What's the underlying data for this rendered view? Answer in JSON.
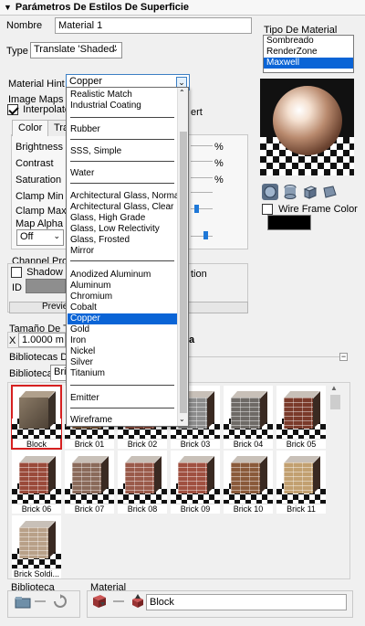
{
  "panel": {
    "title": "Parámetros De Estilos De Superficie"
  },
  "nombre": {
    "label": "Nombre",
    "value": "Material 1"
  },
  "type": {
    "label": "Type",
    "value": "Translate 'Shaded'"
  },
  "tipo_material": {
    "label": "Tipo De Material",
    "options": [
      "Sombreado",
      "RenderZone",
      "Maxwell"
    ],
    "selected": "Maxwell"
  },
  "material_hint": {
    "label": "Material Hint",
    "value": "Copper",
    "options": [
      "Realistic Match",
      "Industrial Coating",
      "Rubber",
      "SSS, Simple",
      "Water",
      "Architectural Glass, Normal",
      "Architectural Glass, Clear",
      "Glass, High Grade",
      "Glass, Low Relectivity",
      "Glass, Frosted",
      "Mirror",
      "Anodized Aluminum",
      "Aluminum",
      "Chromium",
      "Cobalt",
      "Copper",
      "Gold",
      "Iron",
      "Nickel",
      "Silver",
      "Titanium",
      "Emitter",
      "Wireframe"
    ]
  },
  "image_maps": {
    "label": "Image Maps",
    "interpolate_label": "Interpolate",
    "invert_label": "ert",
    "interpolate_checked": true
  },
  "tabs": {
    "color": "Color",
    "second": "Tra"
  },
  "params": {
    "brightness": "Brightness",
    "contrast": "Contrast",
    "saturation": "Saturation",
    "clamp_min": "Clamp Min",
    "clamp_max": "Clamp Max",
    "map_alpha": "Map Alpha C",
    "map_alpha_value": "Off",
    "percent": "%"
  },
  "channel": {
    "label": "Channel Prope",
    "shadow_label": "Shadow Ma",
    "shadow_suffix": "tion",
    "id_label": "ID",
    "preview_label": "Previe"
  },
  "wireframe": {
    "label": "Wire Frame Color"
  },
  "tamano": {
    "label": "Tamaño De Tex",
    "x_label": "X",
    "x_value": "1.0000 m",
    "trailing": "a"
  },
  "bibliotecas": {
    "label": "Bibliotecas De",
    "biblioteca_label": "Biblioteca:",
    "biblioteca_value": "Bric"
  },
  "thumbnails": [
    "Block",
    "Brick 01",
    "Brick 02",
    "Brick 03",
    "Brick 04",
    "Brick 05",
    "Brick 06",
    "Brick 07",
    "Brick 08",
    "Brick 09",
    "Brick 10",
    "Brick 11",
    "Brick Soldi..."
  ],
  "footer": {
    "biblioteca_label": "Biblioteca",
    "material_label": "Material",
    "material_value": "Block"
  },
  "colors": {
    "selection": "#0a64d6",
    "thumb_selected_border": "#d62020"
  }
}
